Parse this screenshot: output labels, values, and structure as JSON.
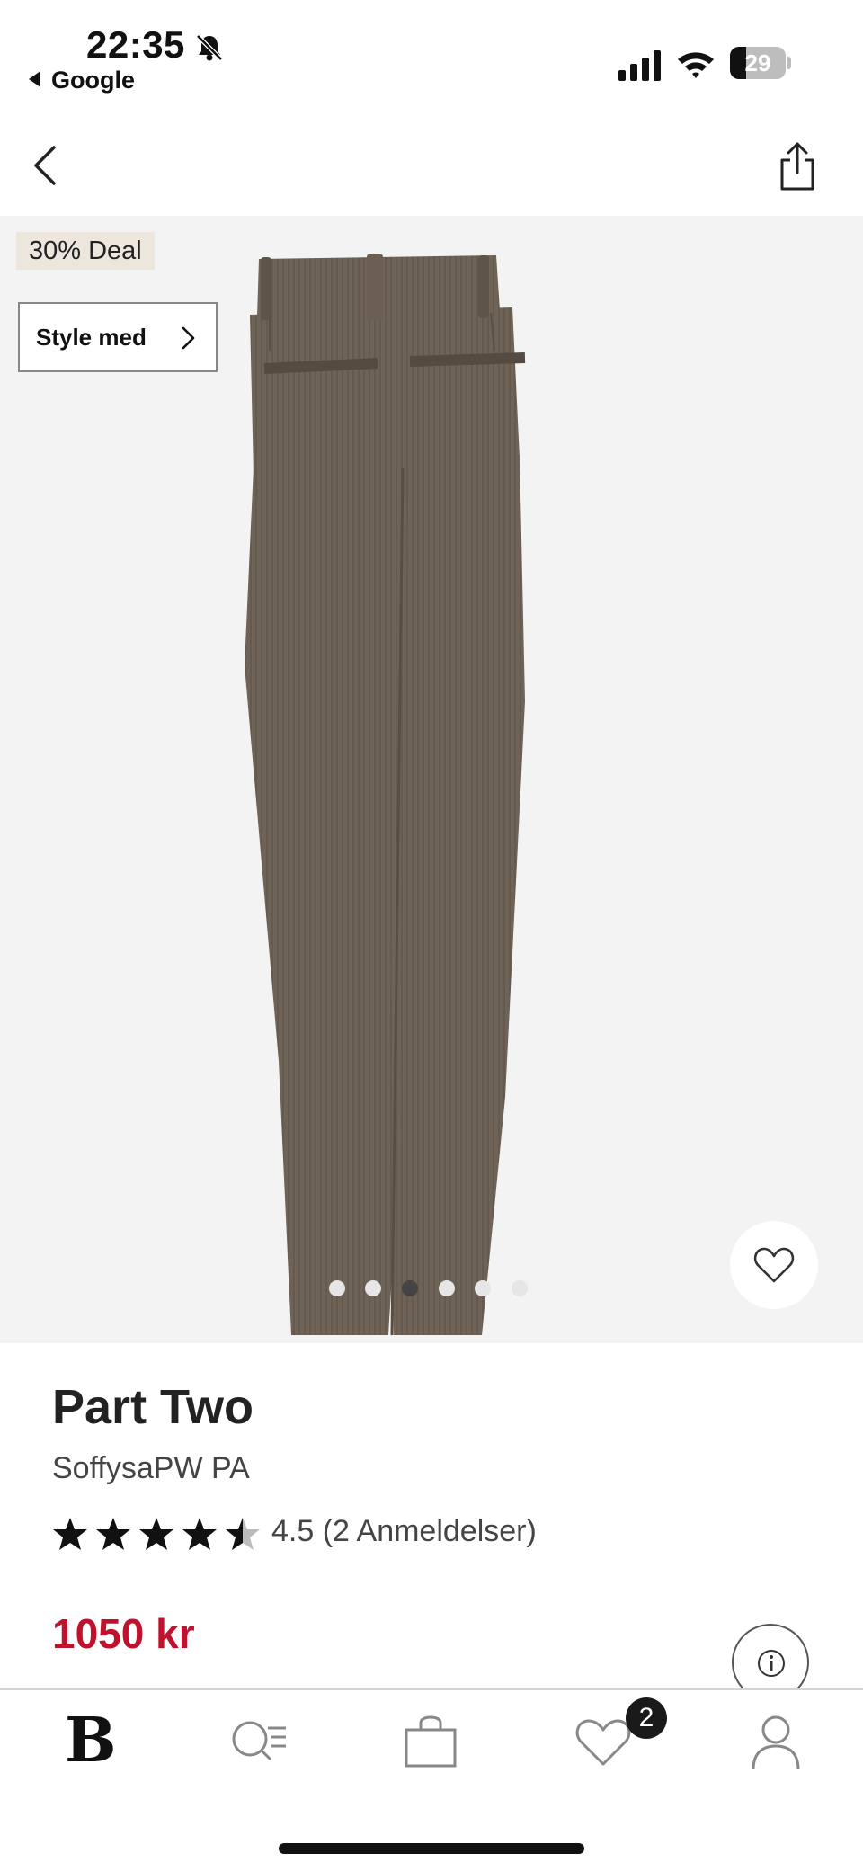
{
  "status_bar": {
    "time": "22:35",
    "back_app": "Google",
    "battery_level": "29",
    "icons": [
      "bell-slash-icon",
      "signal-icon",
      "wifi-icon",
      "battery-icon"
    ]
  },
  "top_nav": {
    "icons": [
      "chevron-left-icon",
      "share-icon"
    ]
  },
  "gallery": {
    "deal_badge": "30% Deal",
    "style_button": "Style med",
    "image_count": 6,
    "active_index": 2,
    "wishlist_icon": "heart-icon"
  },
  "product": {
    "brand": "Part Two",
    "model": "SoffysaPW PA",
    "rating_value": 4.5,
    "rating_text": "4.5 (2 Anmeldelser)",
    "price": "1050 kr",
    "price_color": "#c0122c"
  },
  "tab_bar": {
    "logo": "B",
    "wishlist_count": "2",
    "icons": [
      "brand-logo",
      "search-list-icon",
      "shopping-bag-icon",
      "heart-icon",
      "person-icon"
    ]
  }
}
